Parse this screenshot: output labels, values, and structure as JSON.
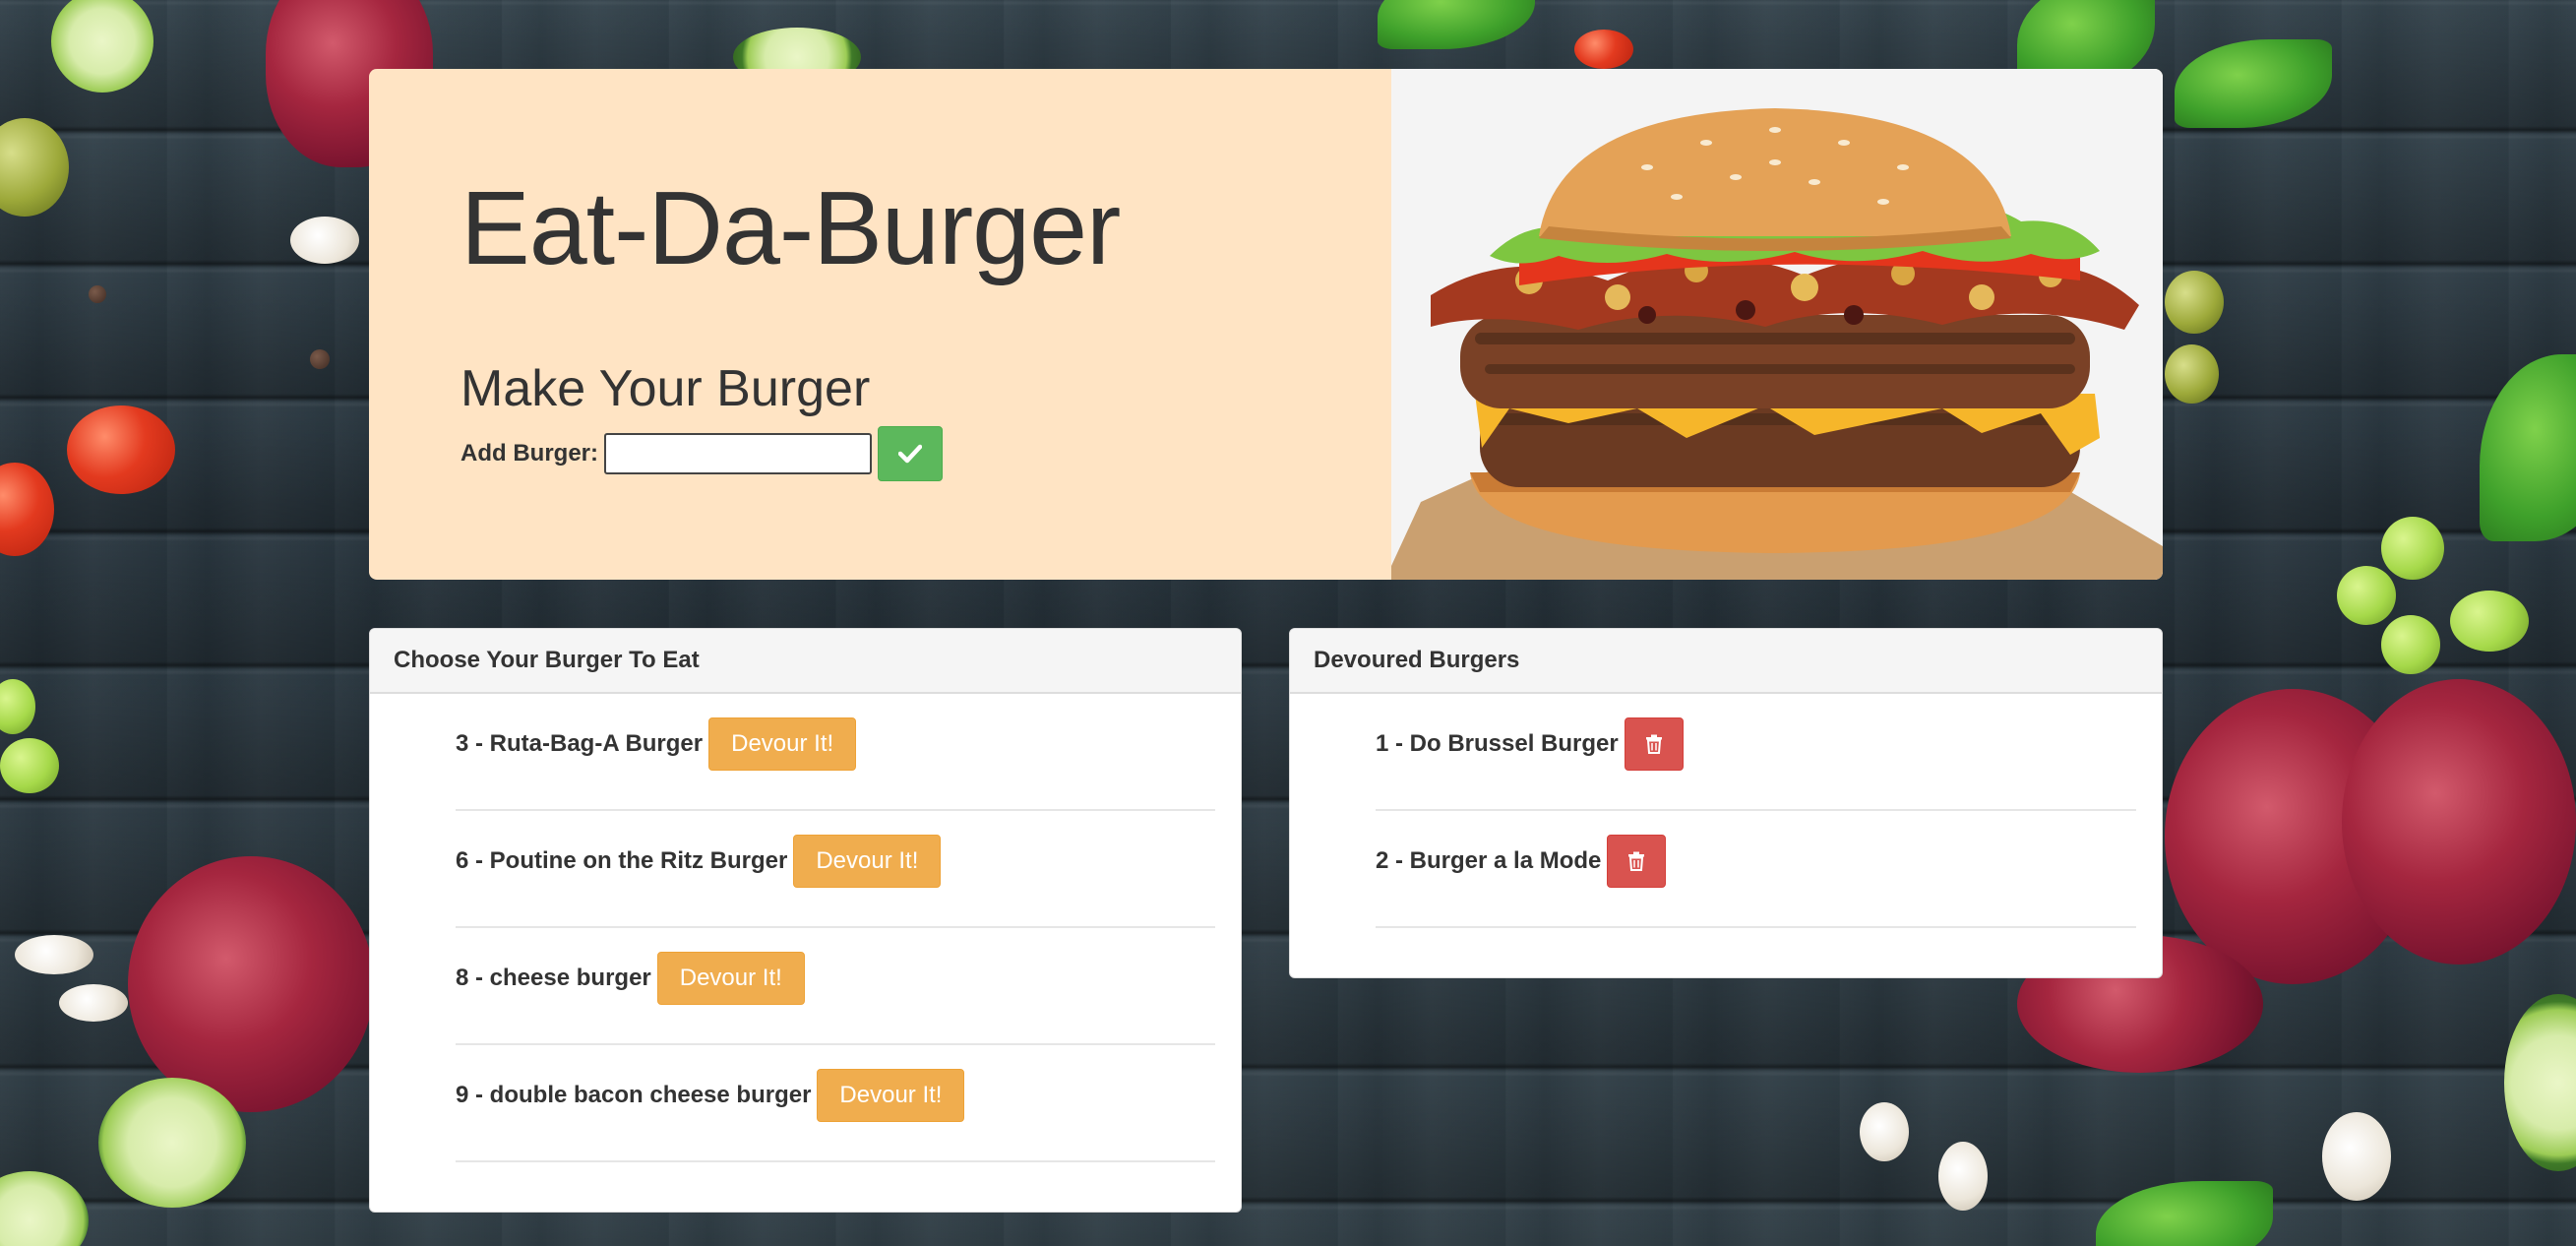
{
  "header": {
    "app_title": "Eat-Da-Burger",
    "form_title": "Make Your Burger",
    "add_label": "Add Burger:",
    "add_input_value": "",
    "add_button_icon": "checkmark-icon",
    "hero_image": "burger-image"
  },
  "to_eat": {
    "heading": "Choose Your Burger To Eat",
    "button_label": "Devour It!",
    "items": [
      {
        "name": "3 - Ruta-Bag-A Burger"
      },
      {
        "name": "6 - Poutine on the Ritz Burger"
      },
      {
        "name": "8 - cheese burger"
      },
      {
        "name": "9 - double bacon cheese burger"
      }
    ]
  },
  "devoured": {
    "heading": "Devoured Burgers",
    "button_icon": "trash-icon",
    "items": [
      {
        "name": "1 - Do Brussel Burger"
      },
      {
        "name": "2 - Burger a la Mode"
      }
    ]
  },
  "colors": {
    "jumbotron_bg": "#ffe4c4",
    "success": "#5cb85c",
    "warning": "#f0ad4e",
    "danger": "#d9534f"
  }
}
